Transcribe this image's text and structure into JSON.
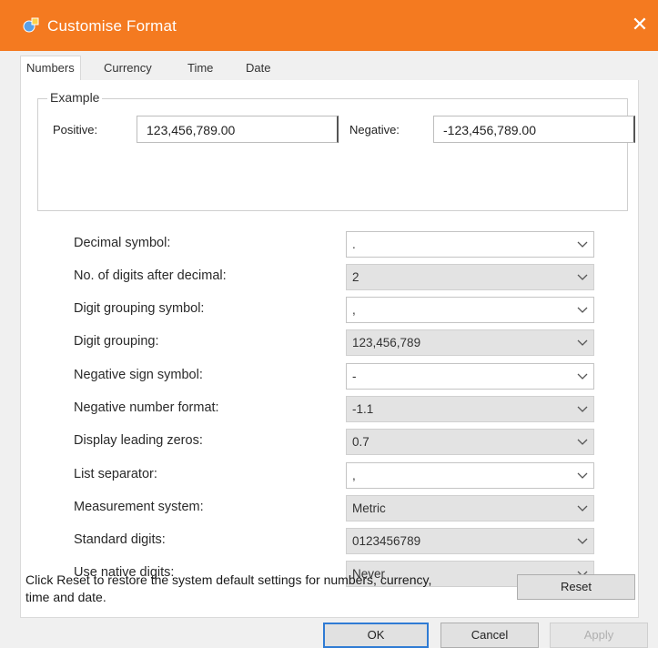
{
  "window": {
    "title": "Customise Format",
    "close_glyph": "✕"
  },
  "tabs": [
    {
      "label": "Numbers",
      "active": true
    },
    {
      "label": "Currency",
      "active": false
    },
    {
      "label": "Time",
      "active": false
    },
    {
      "label": "Date",
      "active": false
    }
  ],
  "example": {
    "legend": "Example",
    "positive_label": "Positive:",
    "positive_value": "123,456,789.00",
    "negative_label": "Negative:",
    "negative_value": "-123,456,789.00"
  },
  "settings": [
    {
      "label": "Decimal symbol:",
      "value": "."
    },
    {
      "label": "No. of digits after decimal:",
      "value": "2"
    },
    {
      "label": "Digit grouping symbol:",
      "value": ","
    },
    {
      "label": "Digit grouping:",
      "value": "123,456,789"
    },
    {
      "label": "Negative sign symbol:",
      "value": "-"
    },
    {
      "label": "Negative number format:",
      "value": "-1.1"
    },
    {
      "label": "Display leading zeros:",
      "value": "0.7"
    },
    {
      "label": "List separator:",
      "value": ","
    },
    {
      "label": "Measurement system:",
      "value": "Metric"
    },
    {
      "label": "Standard digits:",
      "value": "0123456789"
    },
    {
      "label": "Use native digits:",
      "value": "Never"
    }
  ],
  "footer": {
    "hint": "Click Reset to restore the system default settings for numbers, currency, time and date.",
    "reset_label": "Reset",
    "ok_label": "OK",
    "cancel_label": "Cancel",
    "apply_label": "Apply"
  },
  "colors": {
    "titlebar": "#f47a20",
    "default_button_border": "#2f7bd4"
  },
  "icons": {
    "app": "regional-settings-icon",
    "combo": "chevron-down-icon"
  }
}
